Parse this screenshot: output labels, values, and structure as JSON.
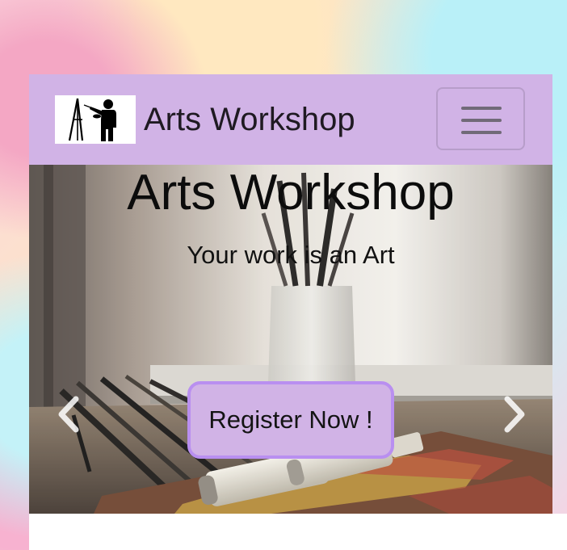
{
  "navbar": {
    "brand_text": "Arts Workshop",
    "logo_icon": "painter-at-easel-icon",
    "toggler_icon": "hamburger-menu-icon",
    "background_color": "#d1b3e6"
  },
  "hero": {
    "title": "Arts Workshop",
    "subtitle": "Your work is an Art",
    "cta_label": "Register Now !",
    "prev_icon": "chevron-left-icon",
    "next_icon": "chevron-right-icon",
    "button_color": "#d1b3e6",
    "button_border_color": "#b98ff0"
  }
}
